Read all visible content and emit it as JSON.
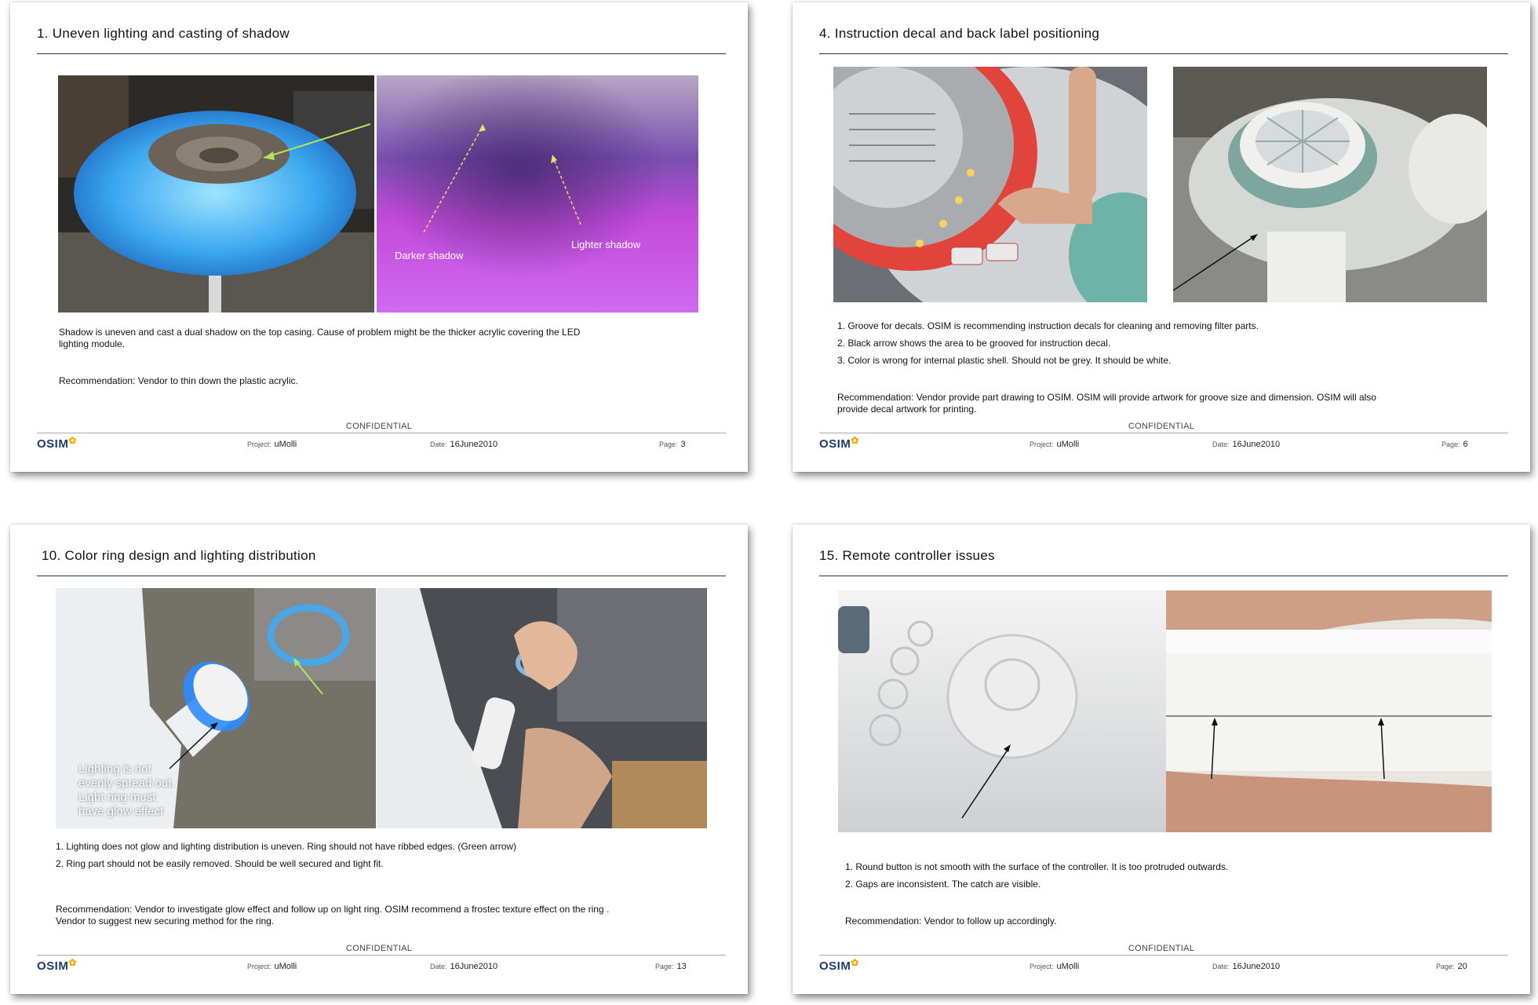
{
  "slides": [
    {
      "title": "1. Uneven lighting and casting of shadow",
      "captions": [
        "Darker shadow",
        "Lighter shadow"
      ],
      "points": [
        "Shadow is uneven and cast a dual shadow on the top casing. Cause of problem might be the thicker acrylic covering the LED lighting module."
      ],
      "recommendation": "Recommendation: Vendor to thin down the plastic acrylic.",
      "confidential": "CONFIDENTIAL",
      "logo": "OSIM",
      "project_label": "Project:",
      "project": "uMolli",
      "date_label": "Date:",
      "date": "16June2010",
      "page_label": "Page:",
      "page": "3"
    },
    {
      "title": "4. Instruction decal and back label positioning",
      "points": [
        "1. Groove for decals. OSIM is recommending instruction decals for cleaning and removing filter parts.",
        "2. Black arrow shows the area to be grooved for instruction decal.",
        "3. Color is wrong for internal plastic shell. Should not be grey. It should be white."
      ],
      "recommendation": "Recommendation: Vendor provide part drawing to OSIM. OSIM will provide artwork for groove size and dimension. OSIM will also provide decal artwork for printing.",
      "confidential": "CONFIDENTIAL",
      "logo": "OSIM",
      "project_label": "Project:",
      "project": "uMolli",
      "date_label": "Date:",
      "date": "16June2010",
      "page_label": "Page:",
      "page": "6"
    },
    {
      "title": "10. Color ring design and lighting distribution",
      "overlay": [
        "Lighting is not",
        "evenly spread out.",
        "Light ring must",
        "have glow effect"
      ],
      "points": [
        "1. Lighting does not glow and lighting distribution is uneven. Ring should not have ribbed edges. (Green arrow)",
        "2. Ring part should not be easily removed. Should be well secured and tight fit."
      ],
      "recommendation": "Recommendation: Vendor to investigate glow effect and follow up on light ring. OSIM recommend a frostec texture effect on the ring . Vendor to suggest new securing method for the ring.",
      "confidential": "CONFIDENTIAL",
      "logo": "OSIM",
      "project_label": "Project:",
      "project": "uMolli",
      "date_label": "Date:",
      "date": "16June2010",
      "page_label": "Page:",
      "page": "13"
    },
    {
      "title": "15. Remote controller issues",
      "points": [
        "1. Round button is not smooth with the surface of the controller. It is too protruded outwards.",
        "2. Gaps are inconsistent. The catch are visible."
      ],
      "recommendation": "Recommendation: Vendor to follow up accordingly.",
      "confidential": "CONFIDENTIAL",
      "logo": "OSIM",
      "project_label": "Project:",
      "project": "uMolli",
      "date_label": "Date:",
      "date": "16June2010",
      "page_label": "Page:",
      "page": "20"
    }
  ]
}
